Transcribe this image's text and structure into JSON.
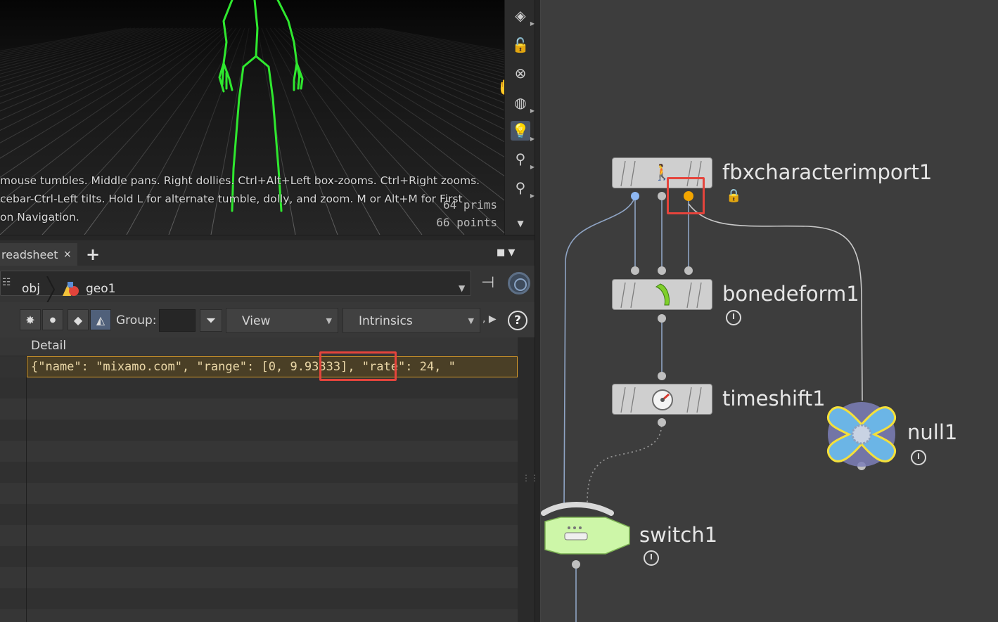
{
  "viewport": {
    "help_lines": [
      "mouse tumbles. Middle pans. Right dollies. Ctrl+Alt+Left box-zooms. Ctrl+Right zooms.",
      "cebar-Ctrl-Left tilts. Hold L for alternate tumble, dolly, and zoom.    M or Alt+M for First",
      "on Navigation."
    ],
    "stats": [
      "64  prims",
      "66 points"
    ],
    "toolbar_icons": [
      "view-mode-icon",
      "lock-icon",
      "cross-pin-icon",
      "sphere-icon",
      "lightbulb-icon",
      "add-light-icon",
      "camera-light-icon",
      "more-arrow-icon"
    ],
    "skeleton_color": "#2fe82f"
  },
  "spreadsheet": {
    "tab_label": "readsheet",
    "tab_close": "×",
    "tab_add": "+",
    "pane_menu": "■ ▼",
    "path": {
      "obj": "obj",
      "geo": "geo1"
    },
    "toolbar": {
      "group_label": "Group:",
      "view_label": "View",
      "intrinsics_label": "Intrinsics",
      "more": ", ▶",
      "help": "?"
    },
    "column_header": "Detail",
    "row_value": "{\"name\": \"mixamo.com\", \"range\": [0, 9.93333], \"rate\": 24, \"",
    "highlighted_value": "9.93333",
    "highlight_color": "#e5443c",
    "selected_row_border": "#d69a2a"
  },
  "network": {
    "nodes": [
      {
        "name": "fbxcharacterimport1",
        "icon": "character-import-icon"
      },
      {
        "name": "bonedeform1",
        "icon": "bone-icon"
      },
      {
        "name": "timeshift1",
        "icon": "clock-gauge-icon"
      },
      {
        "name": "null1",
        "icon": "null-cross-icon"
      },
      {
        "name": "switch1",
        "icon": "switch-icon"
      }
    ],
    "output_highlight_color": "#f2a500",
    "wire_color": "#8fa4c4"
  }
}
